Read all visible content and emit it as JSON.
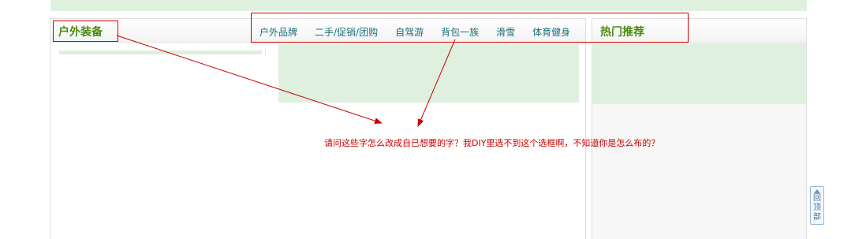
{
  "left_section": {
    "title": "户外装备",
    "nav": [
      "户外品牌",
      "二手/促销/团购",
      "自驾游",
      "背包一族",
      "滑雪",
      "体育健身"
    ]
  },
  "right_section": {
    "title": "热门推荐"
  },
  "annotation": {
    "question": "请问这些字怎么改成自已想要的字？我DIY里选不到这个选框啊，不知道你是怎么布的？",
    "color": "#cc0000"
  },
  "back_to_top": {
    "label": "回顶部",
    "icon": "up-arrow-icon"
  },
  "colors": {
    "accent_green": "#4a8a10",
    "link_teal": "#1d6f7a",
    "light_green": "#dff0df"
  }
}
